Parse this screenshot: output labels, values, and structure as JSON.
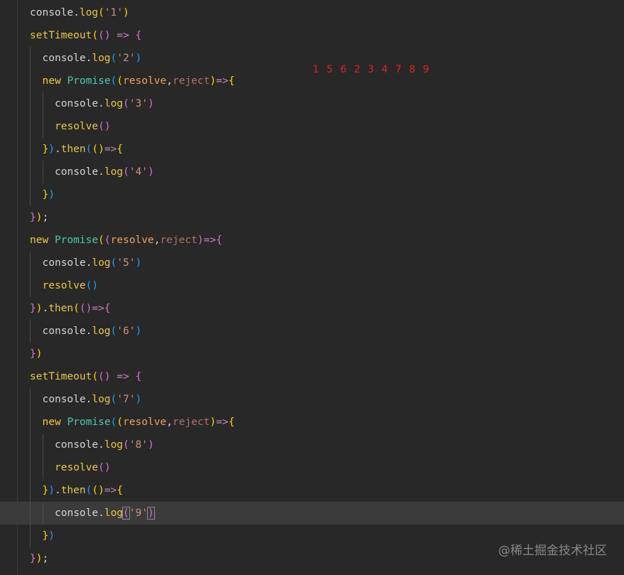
{
  "annotation": "1 5 6 2 3 4 7 8 9",
  "watermark": "@稀土掘金技术社区",
  "code_lines": [
    {
      "indent": 0,
      "tokens": [
        {
          "t": "console",
          "c": "console"
        },
        {
          "t": ".",
          "c": "punct"
        },
        {
          "t": "log",
          "c": "method"
        },
        {
          "t": "(",
          "c": "b1"
        },
        {
          "t": "'1'",
          "c": "str"
        },
        {
          "t": ")",
          "c": "b1"
        }
      ]
    },
    {
      "indent": 0,
      "tokens": [
        {
          "t": "setTimeout",
          "c": "fn"
        },
        {
          "t": "(",
          "c": "b1"
        },
        {
          "t": "(",
          "c": "b2"
        },
        {
          "t": ")",
          "c": "b2"
        },
        {
          "t": " ",
          "c": "plain"
        },
        {
          "t": "=>",
          "c": "arrow"
        },
        {
          "t": " ",
          "c": "plain"
        },
        {
          "t": "{",
          "c": "b2"
        }
      ]
    },
    {
      "indent": 1,
      "tokens": [
        {
          "t": "console",
          "c": "console"
        },
        {
          "t": ".",
          "c": "punct"
        },
        {
          "t": "log",
          "c": "method"
        },
        {
          "t": "(",
          "c": "b3"
        },
        {
          "t": "'2'",
          "c": "str"
        },
        {
          "t": ")",
          "c": "b3"
        }
      ]
    },
    {
      "indent": 1,
      "tokens": [
        {
          "t": "new",
          "c": "kw"
        },
        {
          "t": " ",
          "c": "plain"
        },
        {
          "t": "Promise",
          "c": "cls"
        },
        {
          "t": "(",
          "c": "b3"
        },
        {
          "t": "(",
          "c": "b1"
        },
        {
          "t": "resolve",
          "c": "param"
        },
        {
          "t": ",",
          "c": "punct"
        },
        {
          "t": "reject",
          "c": "param2"
        },
        {
          "t": ")",
          "c": "b1"
        },
        {
          "t": "=>",
          "c": "arrow"
        },
        {
          "t": "{",
          "c": "b1"
        }
      ]
    },
    {
      "indent": 2,
      "tokens": [
        {
          "t": "console",
          "c": "console"
        },
        {
          "t": ".",
          "c": "punct"
        },
        {
          "t": "log",
          "c": "method"
        },
        {
          "t": "(",
          "c": "b2"
        },
        {
          "t": "'3'",
          "c": "str"
        },
        {
          "t": ")",
          "c": "b2"
        }
      ]
    },
    {
      "indent": 2,
      "tokens": [
        {
          "t": "resolve",
          "c": "resolve"
        },
        {
          "t": "(",
          "c": "b2"
        },
        {
          "t": ")",
          "c": "b2"
        }
      ]
    },
    {
      "indent": 1,
      "tokens": [
        {
          "t": "}",
          "c": "b1"
        },
        {
          "t": ")",
          "c": "b3"
        },
        {
          "t": ".",
          "c": "punct"
        },
        {
          "t": "then",
          "c": "then"
        },
        {
          "t": "(",
          "c": "b3"
        },
        {
          "t": "(",
          "c": "b1"
        },
        {
          "t": ")",
          "c": "b1"
        },
        {
          "t": "=>",
          "c": "arrow"
        },
        {
          "t": "{",
          "c": "b1"
        }
      ]
    },
    {
      "indent": 2,
      "tokens": [
        {
          "t": "console",
          "c": "console"
        },
        {
          "t": ".",
          "c": "punct"
        },
        {
          "t": "log",
          "c": "method"
        },
        {
          "t": "(",
          "c": "b2"
        },
        {
          "t": "'4'",
          "c": "str"
        },
        {
          "t": ")",
          "c": "b2"
        }
      ]
    },
    {
      "indent": 1,
      "tokens": [
        {
          "t": "}",
          "c": "b1"
        },
        {
          "t": ")",
          "c": "b3"
        }
      ]
    },
    {
      "indent": 0,
      "tokens": [
        {
          "t": "}",
          "c": "b2"
        },
        {
          "t": ")",
          "c": "b1"
        },
        {
          "t": ";",
          "c": "punct"
        }
      ]
    },
    {
      "indent": 0,
      "tokens": [
        {
          "t": "new",
          "c": "kw"
        },
        {
          "t": " ",
          "c": "plain"
        },
        {
          "t": "Promise",
          "c": "cls"
        },
        {
          "t": "(",
          "c": "b1"
        },
        {
          "t": "(",
          "c": "b2"
        },
        {
          "t": "resolve",
          "c": "param"
        },
        {
          "t": ",",
          "c": "punct"
        },
        {
          "t": "reject",
          "c": "param2"
        },
        {
          "t": ")",
          "c": "b2"
        },
        {
          "t": "=>",
          "c": "arrow"
        },
        {
          "t": "{",
          "c": "b2"
        }
      ]
    },
    {
      "indent": 1,
      "tokens": [
        {
          "t": "console",
          "c": "console"
        },
        {
          "t": ".",
          "c": "punct"
        },
        {
          "t": "log",
          "c": "method"
        },
        {
          "t": "(",
          "c": "b3"
        },
        {
          "t": "'5'",
          "c": "str"
        },
        {
          "t": ")",
          "c": "b3"
        }
      ]
    },
    {
      "indent": 1,
      "tokens": [
        {
          "t": "resolve",
          "c": "resolve"
        },
        {
          "t": "(",
          "c": "b3"
        },
        {
          "t": ")",
          "c": "b3"
        }
      ]
    },
    {
      "indent": 0,
      "tokens": [
        {
          "t": "}",
          "c": "b2"
        },
        {
          "t": ")",
          "c": "b1"
        },
        {
          "t": ".",
          "c": "punct"
        },
        {
          "t": "then",
          "c": "then"
        },
        {
          "t": "(",
          "c": "b1"
        },
        {
          "t": "(",
          "c": "b2"
        },
        {
          "t": ")",
          "c": "b2"
        },
        {
          "t": "=>",
          "c": "arrow"
        },
        {
          "t": "{",
          "c": "b2"
        }
      ]
    },
    {
      "indent": 1,
      "tokens": [
        {
          "t": "console",
          "c": "console"
        },
        {
          "t": ".",
          "c": "punct"
        },
        {
          "t": "log",
          "c": "method"
        },
        {
          "t": "(",
          "c": "b3"
        },
        {
          "t": "'6'",
          "c": "str"
        },
        {
          "t": ")",
          "c": "b3"
        }
      ]
    },
    {
      "indent": 0,
      "tokens": [
        {
          "t": "}",
          "c": "b2"
        },
        {
          "t": ")",
          "c": "b1"
        }
      ]
    },
    {
      "indent": 0,
      "tokens": [
        {
          "t": "setTimeout",
          "c": "fn"
        },
        {
          "t": "(",
          "c": "b1"
        },
        {
          "t": "(",
          "c": "b2"
        },
        {
          "t": ")",
          "c": "b2"
        },
        {
          "t": " ",
          "c": "plain"
        },
        {
          "t": "=>",
          "c": "arrow"
        },
        {
          "t": " ",
          "c": "plain"
        },
        {
          "t": "{",
          "c": "b2"
        }
      ]
    },
    {
      "indent": 1,
      "tokens": [
        {
          "t": "console",
          "c": "console"
        },
        {
          "t": ".",
          "c": "punct"
        },
        {
          "t": "log",
          "c": "method"
        },
        {
          "t": "(",
          "c": "b3"
        },
        {
          "t": "'7'",
          "c": "str"
        },
        {
          "t": ")",
          "c": "b3"
        }
      ]
    },
    {
      "indent": 1,
      "tokens": [
        {
          "t": "new",
          "c": "kw"
        },
        {
          "t": " ",
          "c": "plain"
        },
        {
          "t": "Promise",
          "c": "cls"
        },
        {
          "t": "(",
          "c": "b3"
        },
        {
          "t": "(",
          "c": "b1"
        },
        {
          "t": "resolve",
          "c": "param"
        },
        {
          "t": ",",
          "c": "punct"
        },
        {
          "t": "reject",
          "c": "param2"
        },
        {
          "t": ")",
          "c": "b1"
        },
        {
          "t": "=>",
          "c": "arrow"
        },
        {
          "t": "{",
          "c": "b1"
        }
      ]
    },
    {
      "indent": 2,
      "tokens": [
        {
          "t": "console",
          "c": "console"
        },
        {
          "t": ".",
          "c": "punct"
        },
        {
          "t": "log",
          "c": "method"
        },
        {
          "t": "(",
          "c": "b2"
        },
        {
          "t": "'8'",
          "c": "str"
        },
        {
          "t": ")",
          "c": "b2"
        }
      ]
    },
    {
      "indent": 2,
      "tokens": [
        {
          "t": "resolve",
          "c": "resolve"
        },
        {
          "t": "(",
          "c": "b2"
        },
        {
          "t": ")",
          "c": "b2"
        }
      ]
    },
    {
      "indent": 1,
      "tokens": [
        {
          "t": "}",
          "c": "b1"
        },
        {
          "t": ")",
          "c": "b3"
        },
        {
          "t": ".",
          "c": "punct"
        },
        {
          "t": "then",
          "c": "then"
        },
        {
          "t": "(",
          "c": "b3"
        },
        {
          "t": "(",
          "c": "b1"
        },
        {
          "t": ")",
          "c": "b1"
        },
        {
          "t": "=>",
          "c": "arrow"
        },
        {
          "t": "{",
          "c": "b1"
        }
      ]
    },
    {
      "indent": 2,
      "current": true,
      "tokens": [
        {
          "t": "console",
          "c": "console"
        },
        {
          "t": ".",
          "c": "punct"
        },
        {
          "t": "log",
          "c": "method"
        },
        {
          "t": "(",
          "c": "b2",
          "match": true
        },
        {
          "t": "'9'",
          "c": "str"
        },
        {
          "t": ")",
          "c": "b2",
          "match": true
        }
      ]
    },
    {
      "indent": 1,
      "tokens": [
        {
          "t": "}",
          "c": "b1"
        },
        {
          "t": ")",
          "c": "b3"
        }
      ]
    },
    {
      "indent": 0,
      "tokens": [
        {
          "t": "}",
          "c": "b2"
        },
        {
          "t": ")",
          "c": "b1"
        },
        {
          "t": ";",
          "c": "punct"
        }
      ]
    }
  ]
}
